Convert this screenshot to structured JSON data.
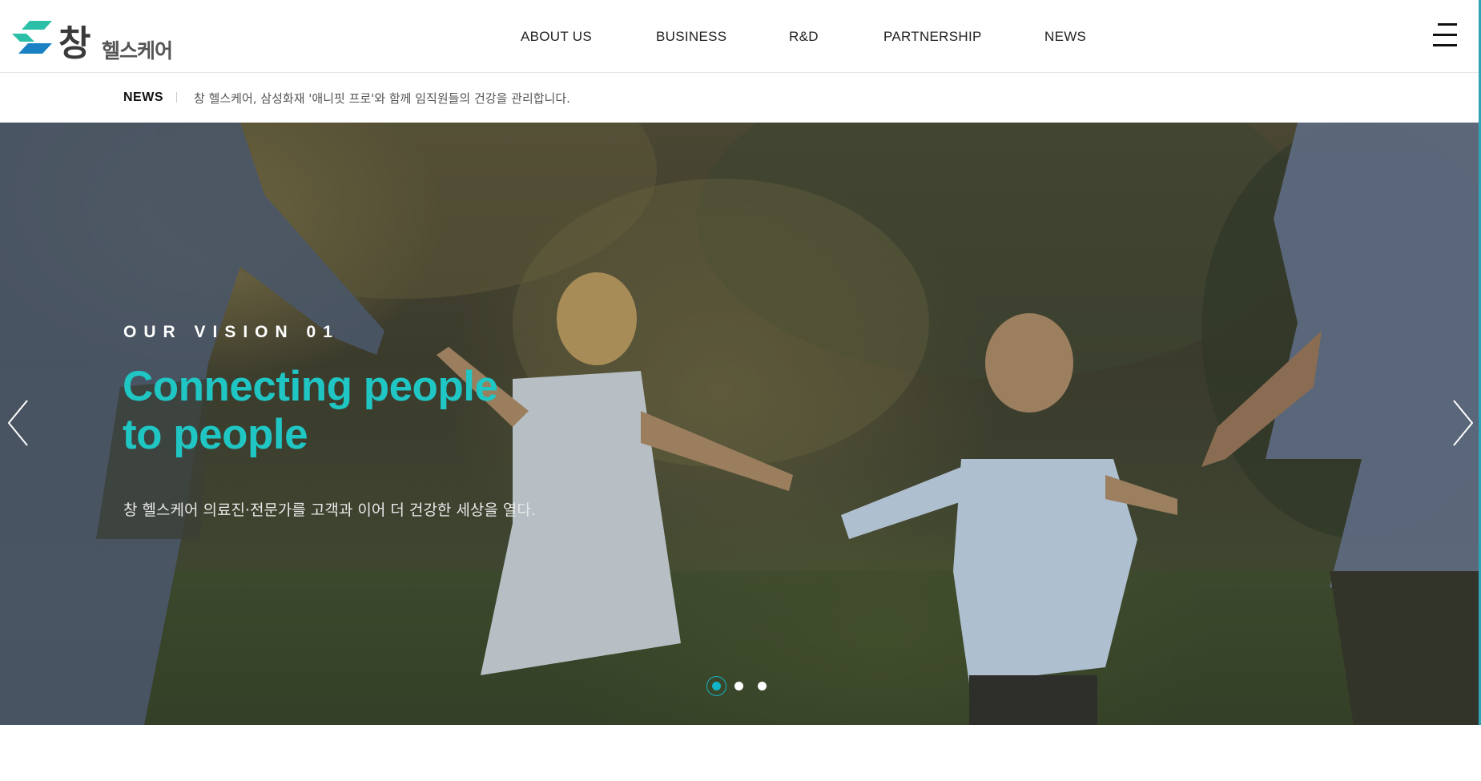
{
  "brand": {
    "logo_main": "창",
    "logo_sub": "헬스케어",
    "colors": {
      "accent": "#1fc6c4",
      "mark_teal": "#2bbfa8",
      "mark_blue": "#1a82c4",
      "dot_active": "#12b3c4"
    }
  },
  "nav": {
    "items": [
      {
        "label": "ABOUT US"
      },
      {
        "label": "BUSINESS"
      },
      {
        "label": "R&D"
      },
      {
        "label": "PARTNERSHIP"
      },
      {
        "label": "NEWS"
      }
    ],
    "menu_icon": "hamburger-menu-icon"
  },
  "ticker": {
    "label": "NEWS",
    "headline": "창 헬스케어, 삼성화재 '애니핏 프로'와 함께 임직원들의 건강을 관리합니다."
  },
  "hero": {
    "eyebrow": "OUR VISION 01",
    "title_line1": "Connecting people",
    "title_line2": "to people",
    "description": "창 헬스케어 의료진·전문가를 고객과 이어 더 건강한 세상을 열다.",
    "prev_icon": "chevron-left-icon",
    "next_icon": "chevron-right-icon",
    "slides_total": 3,
    "current_slide": 1
  }
}
